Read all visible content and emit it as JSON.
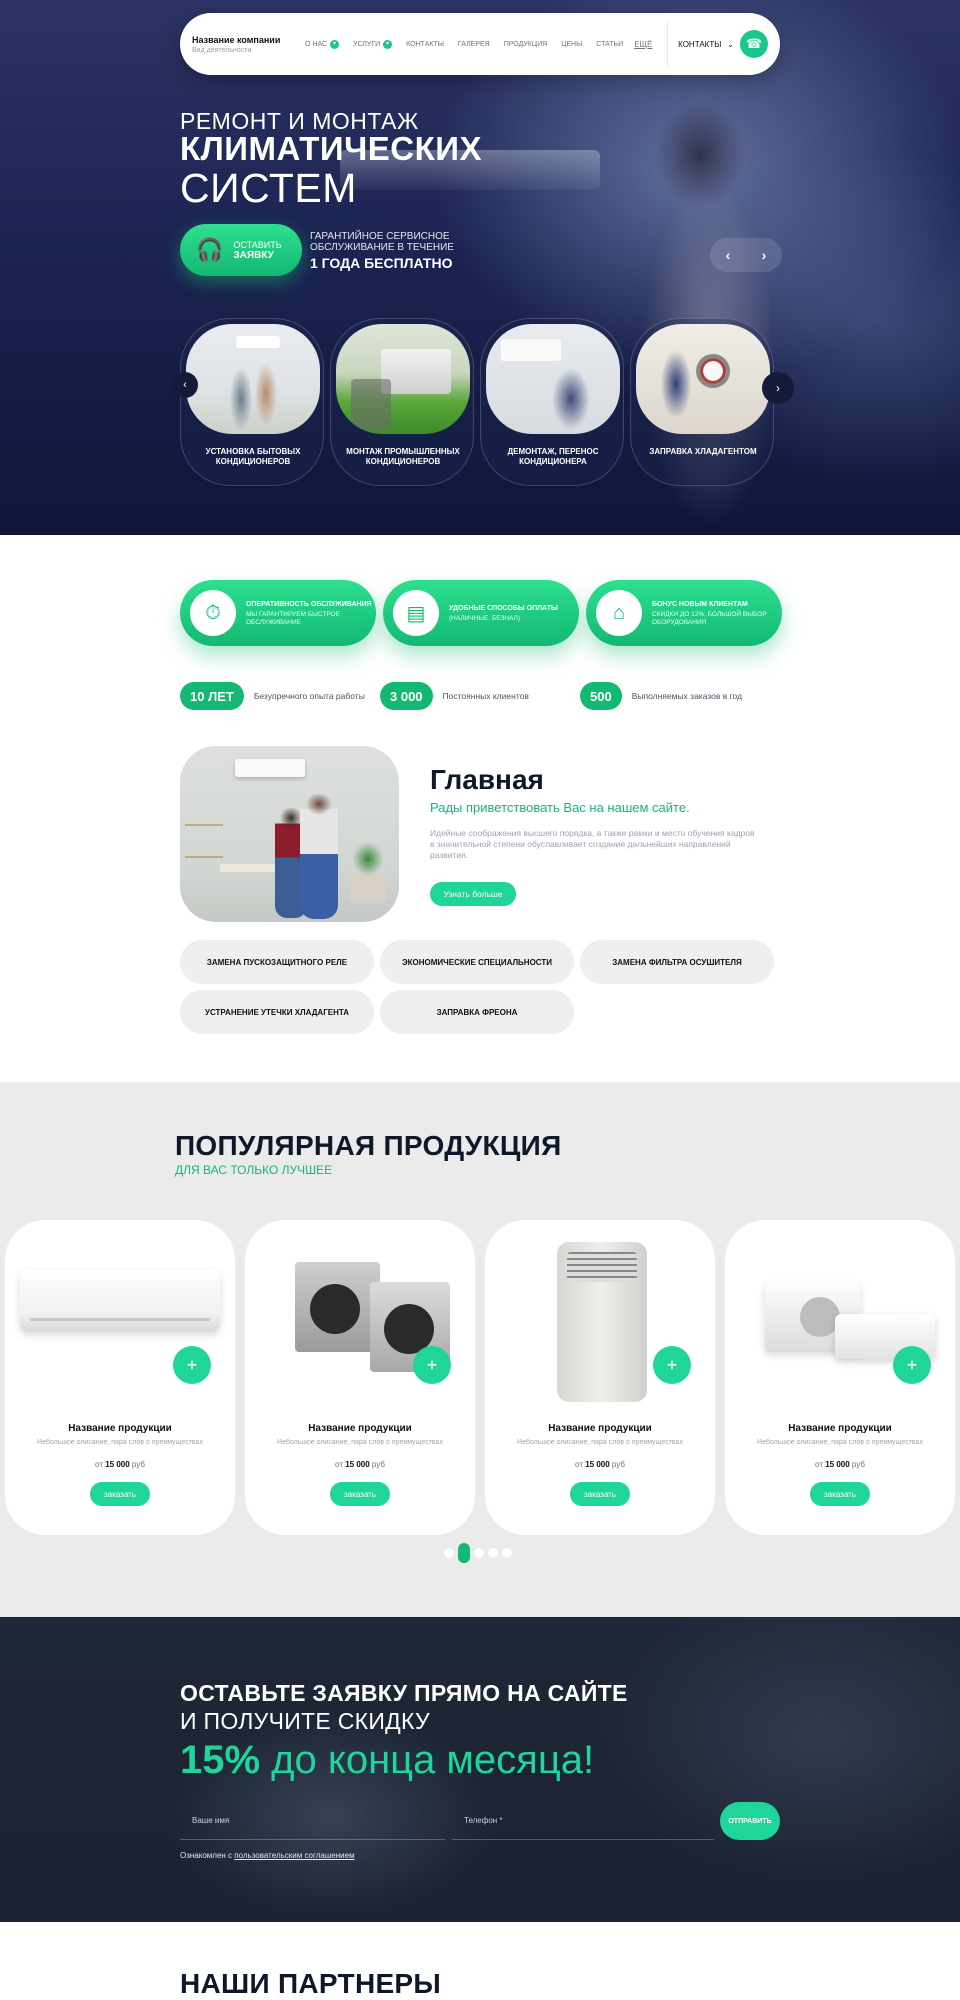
{
  "header": {
    "company_name": "Название компании",
    "company_sub": "Вид деятельности",
    "nav": [
      {
        "label": "О НАС",
        "badge": "▾"
      },
      {
        "label": "УСЛУГИ",
        "badge": "▾"
      },
      {
        "label": "КОНТАКТЫ"
      },
      {
        "label": "ГАЛЕРЕЯ"
      },
      {
        "label": "ПРОДУКЦИЯ"
      },
      {
        "label": "ЦЕНЫ"
      },
      {
        "label": "СТАТЬИ"
      }
    ],
    "more_label": "ЕЩЁ",
    "contacts_label": "КОНТАКТЫ",
    "contacts_chevron": "⌄",
    "phone_icon": "☎"
  },
  "hero": {
    "line1": "РЕМОНТ И МОНТАЖ",
    "line2": "КЛИМАТИЧЕСКИХ",
    "line3": "СИСТЕМ",
    "cta_line1": "ОСТАВИТЬ",
    "cta_line2": "ЗАЯВКУ",
    "cta_icon": "🎧",
    "warranty_small": "ГАРАНТИЙНОЕ СЕРВИСНОЕ ОБСЛУЖИВАНИЕ В ТЕЧЕНИЕ",
    "warranty_big": "1 ГОДА БЕСПЛАТНО",
    "arrow_prev": "‹",
    "arrow_next": "›",
    "services": [
      {
        "title": "УСТАНОВКА БЫТОВЫХ КОНДИЦИОНЕРОВ"
      },
      {
        "title": "МОНТАЖ ПРОМЫШЛЕННЫХ КОНДИЦИОНЕРОВ"
      },
      {
        "title": "ДЕМОНТАЖ, ПЕРЕНОС КОНДИЦИОНЕРА"
      },
      {
        "title": "ЗАПРАВКА ХЛАДАГЕНТОМ"
      }
    ],
    "services_prev": "‹",
    "services_next": "›"
  },
  "features": [
    {
      "title": "ОПЕРАТИВНОСТЬ ОБСЛУЖИВАНИЯ",
      "sub": "МЫ ГАРАНТИРУЕМ БЫСТРОЕ ОБСЛУЖИВАНИЕ",
      "icon": "⏱"
    },
    {
      "title": "УДОБНЫЕ СПОСОБЫ ОПЛАТЫ",
      "sub": "(НАЛИЧНЫЕ, БЕЗНАЛ)",
      "icon": "▤"
    },
    {
      "title": "БОНУС НОВЫМ КЛИЕНТАМ",
      "sub": "СКИДКИ ДО 12%, БОЛЬШОЙ ВЫБОР ОБОРУДОВАНИЯ",
      "icon": "⌂"
    }
  ],
  "stats": [
    {
      "value": "10 ЛЕТ",
      "text": "Безупречного опыта работы"
    },
    {
      "value": "3 000",
      "text": "Постоянных клиентов"
    },
    {
      "value": "500",
      "text": "Выполняемых заказов в год"
    }
  ],
  "about": {
    "title": "Главная",
    "subtitle": "Рады приветствовать Вас на нашем сайте.",
    "text": "Идейные соображения высшего порядка, а также рамки и место обучения кадров в значительной степени обуславливает создание дальнейших направлений развития.",
    "button": "Узнать больше"
  },
  "tags": [
    "ЗАМЕНА ПУСКОЗАЩИТНОГО РЕЛЕ",
    "ЭКОНОМИЧЕСКИЕ СПЕЦИАЛЬНОСТИ",
    "ЗАМЕНА ФИЛЬТРА ОСУШИТЕЛЯ",
    "УСТРАНЕНИЕ УТЕЧКИ ХЛАДАГЕНТА",
    "ЗАПРАВКА ФРЕОНА"
  ],
  "products": {
    "title": "ПОПУЛЯРНАЯ ПРОДУКЦИЯ",
    "subtitle": "ДЛЯ ВАС ТОЛЬКО ЛУЧШЕЕ",
    "plus": "+",
    "items": [
      {
        "name": "Название продукции",
        "desc": "Небольшое описание, пара слов о преимуществах",
        "price_prefix": "от",
        "price": "15 000",
        "currency": "руб",
        "button": "заказать"
      },
      {
        "name": "Название продукции",
        "desc": "Небольшое описание, пара слов о преимуществах",
        "price_prefix": "от",
        "price": "15 000",
        "currency": "руб",
        "button": "заказать"
      },
      {
        "name": "Название продукции",
        "desc": "Небольшое описание, пара слов о преимуществах",
        "price_prefix": "от",
        "price": "15 000",
        "currency": "руб",
        "button": "заказать"
      },
      {
        "name": "Название продукции",
        "desc": "Небольшое описание, пара слов о преимуществах",
        "price_prefix": "от",
        "price": "15 000",
        "currency": "руб",
        "button": "заказать"
      }
    ],
    "pager_active_index": 1,
    "pager_count": 5
  },
  "form": {
    "line1": "ОСТАВЬТЕ ЗАЯВКУ ПРЯМО НА САЙТЕ",
    "line2": "И ПОЛУЧИТЕ СКИДКУ",
    "percent": "15%",
    "percent_rest": " до конца месяца!",
    "name_placeholder": "Ваше имя",
    "phone_placeholder": "Телефон *",
    "send": "ОТПРАВИТЬ",
    "agree_prefix": "Ознакомлен с ",
    "agree_link": "пользовательским соглашением"
  },
  "partners": {
    "title": "НАШИ ПАРТНЕРЫ"
  },
  "colors": {
    "accent": "#13b872",
    "accent_light": "#1fd59a",
    "hero_dark": "#0e1638",
    "form_bg": "#1f2838"
  }
}
